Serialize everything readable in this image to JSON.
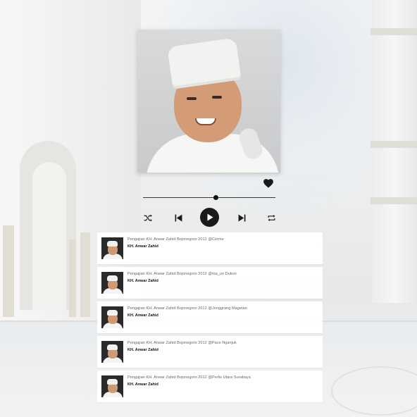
{
  "player": {
    "progress_fraction": 0.55,
    "liked": true,
    "controls": {
      "shuffle": "shuffle-icon",
      "previous": "skip-previous-icon",
      "play": "play-icon",
      "next": "skip-next-icon",
      "repeat": "repeat-icon",
      "like": "heart-icon"
    }
  },
  "playlist": {
    "items": [
      {
        "title": "Pengajian KH. Anwar Zahid Bojonegoro 2012 @Cerme",
        "artist": "KH. Anwar Zahid"
      },
      {
        "title": "Pengajian KH. Anwar Zahid Bojonegoro 2012 @ma_un Dukun",
        "artist": "KH. Anwar Zahid"
      },
      {
        "title": "Pengajian KH. Anwar Zahid Bojonegoro 2012 @Jonggrang Magetan",
        "artist": "KH. Anwar Zahid"
      },
      {
        "title": "Pengajian KH. Anwar Zahid Bojonegoro 2012 @Pace Nganjuk",
        "artist": "KH. Anwar Zahid"
      },
      {
        "title": "Pengajian KH. Anwar Zahid Bojonegoro 2012 @Perlis Utara Surabaya",
        "artist": "KH. Anwar Zahid"
      }
    ]
  },
  "colors": {
    "control": "#1a1a1a",
    "card_bg": "#ffffff",
    "title_text": "#666666",
    "artist_text": "#111111"
  }
}
